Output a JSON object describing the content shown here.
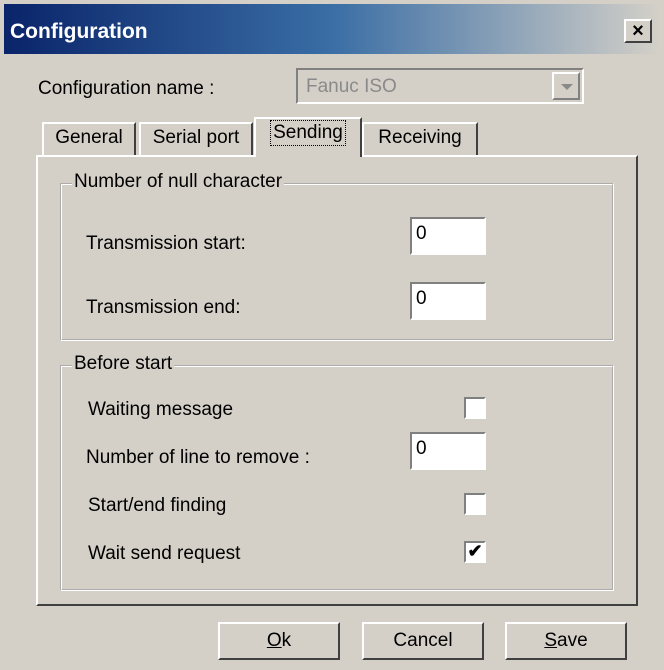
{
  "window": {
    "title": "Configuration",
    "close_glyph": "×"
  },
  "config": {
    "name_label": "Configuration name :",
    "name_value": "Fanuc ISO"
  },
  "tabs": [
    {
      "label": "General"
    },
    {
      "label": "Serial port"
    },
    {
      "label": "Sending",
      "active": true
    },
    {
      "label": "Receiving"
    }
  ],
  "null_char": {
    "title": "Number of null character",
    "start_label": "Transmission start:",
    "start_value": "0",
    "end_label": "Transmission end:",
    "end_value": "0"
  },
  "before_start": {
    "title": "Before start",
    "waiting_message_label": "Waiting message",
    "waiting_message_checked": false,
    "lines_remove_label": "Number of line to remove :",
    "lines_remove_value": "0",
    "start_end_finding_label": "Start/end finding",
    "start_end_finding_checked": false,
    "wait_send_request_label": "Wait send request",
    "wait_send_request_checked": true,
    "check_mark": "✔"
  },
  "buttons": {
    "ok_mnemonic": "O",
    "ok_rest": "k",
    "cancel": "Cancel",
    "save_mnemonic": "S",
    "save_rest": "ave"
  },
  "colors": {
    "titlebar_start": "#0a246a",
    "face": "#d4d0c8"
  }
}
